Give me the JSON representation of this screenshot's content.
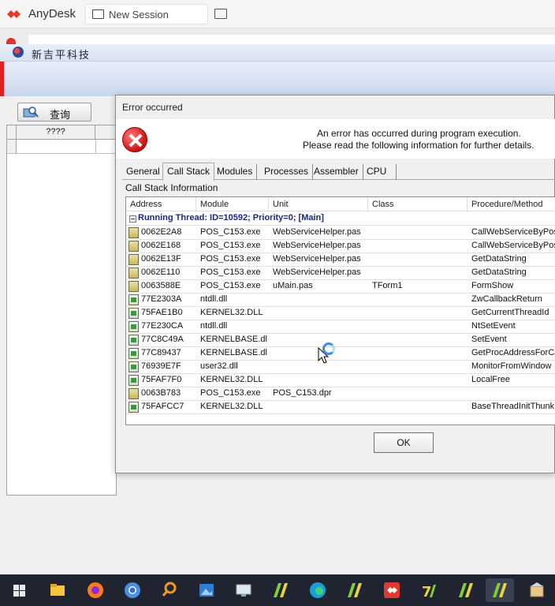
{
  "anydesk": {
    "app_name": "AnyDesk",
    "tab_label": "New Session",
    "icons": {
      "logo": "anydesk-logo-icon",
      "tab": "monitor-icon",
      "switch": "display-icon"
    }
  },
  "remote_app": {
    "title": "新吉平科技",
    "query_button": "查询",
    "grid_header": "????"
  },
  "dialog": {
    "title": "Error occurred",
    "message_line1": "An error has occurred during program execution.",
    "message_line2": "Please read the following information for further details.",
    "tabs": [
      "General",
      "Call Stack",
      "Modules",
      "Processes",
      "Assembler",
      "CPU"
    ],
    "active_tab": "Call Stack",
    "section_label": "Call Stack Information",
    "columns": [
      "Address",
      "Module",
      "Unit",
      "Class",
      "Procedure/Method"
    ],
    "thread_label": "Running Thread: ID=10592; Priority=0; [Main]",
    "rows": [
      {
        "address": "0062E2A8",
        "module": "POS_C153.exe",
        "unit": "WebServiceHelper.pas",
        "class": "",
        "procedure": "CallWebServiceByPost",
        "icon": "pkg"
      },
      {
        "address": "0062E168",
        "module": "POS_C153.exe",
        "unit": "WebServiceHelper.pas",
        "class": "",
        "procedure": "CallWebServiceByPost",
        "icon": "pkg"
      },
      {
        "address": "0062E13F",
        "module": "POS_C153.exe",
        "unit": "WebServiceHelper.pas",
        "class": "",
        "procedure": "GetDataString",
        "icon": "pkg"
      },
      {
        "address": "0062E110",
        "module": "POS_C153.exe",
        "unit": "WebServiceHelper.pas",
        "class": "",
        "procedure": "GetDataString",
        "icon": "pkg"
      },
      {
        "address": "0063588E",
        "module": "POS_C153.exe",
        "unit": "uMain.pas",
        "class": "TForm1",
        "procedure": "FormShow",
        "icon": "pkg"
      },
      {
        "address": "77E2303A",
        "module": "ntdll.dll",
        "unit": "",
        "class": "",
        "procedure": "ZwCallbackReturn",
        "icon": "mod"
      },
      {
        "address": "75FAE1B0",
        "module": "KERNEL32.DLL",
        "unit": "",
        "class": "",
        "procedure": "GetCurrentThreadId",
        "icon": "mod"
      },
      {
        "address": "77E230CA",
        "module": "ntdll.dll",
        "unit": "",
        "class": "",
        "procedure": "NtSetEvent",
        "icon": "mod"
      },
      {
        "address": "77C8C49A",
        "module": "KERNELBASE.dll",
        "unit": "",
        "class": "",
        "procedure": "SetEvent",
        "icon": "mod"
      },
      {
        "address": "77C89437",
        "module": "KERNELBASE.dll",
        "unit": "",
        "class": "",
        "procedure": "GetProcAddressForCa",
        "icon": "mod"
      },
      {
        "address": "76939E7F",
        "module": "user32.dll",
        "unit": "",
        "class": "",
        "procedure": "MonitorFromWindow",
        "icon": "mod"
      },
      {
        "address": "75FAF7F0",
        "module": "KERNEL32.DLL",
        "unit": "",
        "class": "",
        "procedure": "LocalFree",
        "icon": "mod"
      },
      {
        "address": "0063B783",
        "module": "POS_C153.exe",
        "unit": "POS_C153.dpr",
        "class": "",
        "procedure": "",
        "icon": "pkg"
      },
      {
        "address": "75FAFCC7",
        "module": "KERNEL32.DLL",
        "unit": "",
        "class": "",
        "procedure": "BaseThreadInitThunk",
        "icon": "mod"
      }
    ],
    "ok_button": "OK"
  },
  "taskbar": {
    "items": [
      "start-icon",
      "file-explorer-icon",
      "firefox-icon",
      "chrome-icon",
      "search-magnifier-icon",
      "photos-icon",
      "remote-desktop-icon",
      "pos-app-icon",
      "edge-icon",
      "pos-app-icon",
      "anydesk-icon",
      "delphi-icon",
      "pos-app-icon",
      "pos-app-icon",
      "package-icon"
    ],
    "active_index": 13
  },
  "colors": {
    "accent_red": "#e02020",
    "thread_text": "#1b2a7a",
    "taskbar_bg": "#1f2430"
  }
}
